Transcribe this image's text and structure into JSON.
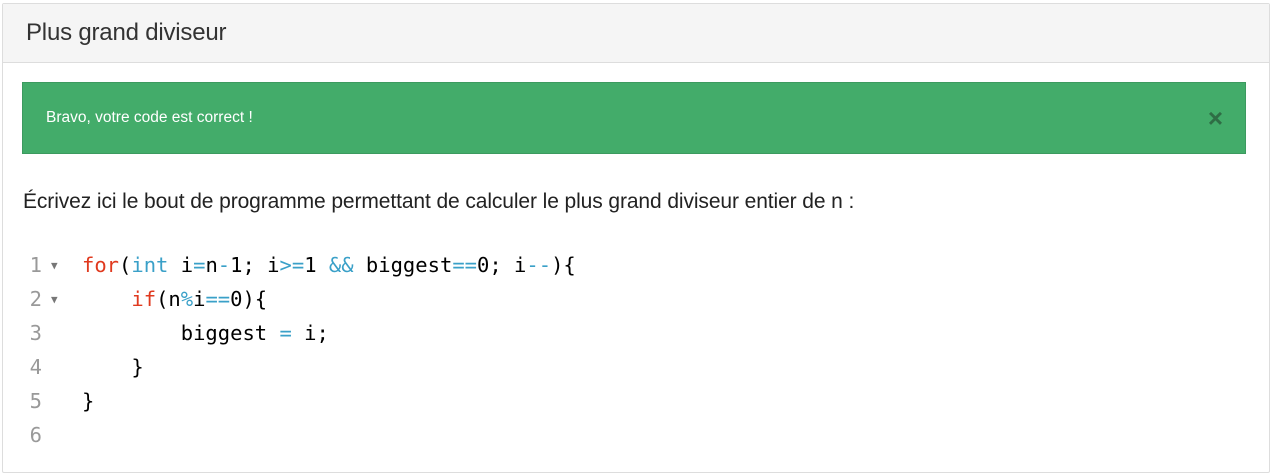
{
  "panel": {
    "title": "Plus grand diviseur"
  },
  "alert": {
    "message": "Bravo, votre code est correct !",
    "close_symbol": "×",
    "background_color": "#43ac6a"
  },
  "prompt": {
    "text": "Écrivez ici le bout de programme permettant de calculer le plus grand diviseur entier de n :"
  },
  "editor": {
    "lines": [
      {
        "number": "1",
        "foldable": true,
        "indent": "",
        "tokens": [
          {
            "t": "kw",
            "v": "for"
          },
          {
            "t": "plain",
            "v": "("
          },
          {
            "t": "ty",
            "v": "int"
          },
          {
            "t": "plain",
            "v": " i"
          },
          {
            "t": "op",
            "v": "="
          },
          {
            "t": "plain",
            "v": "n"
          },
          {
            "t": "op",
            "v": "-"
          },
          {
            "t": "plain",
            "v": "1; i"
          },
          {
            "t": "op",
            "v": ">="
          },
          {
            "t": "plain",
            "v": "1 "
          },
          {
            "t": "op",
            "v": "&&"
          },
          {
            "t": "plain",
            "v": " biggest"
          },
          {
            "t": "op",
            "v": "=="
          },
          {
            "t": "plain",
            "v": "0; i"
          },
          {
            "t": "op",
            "v": "--"
          },
          {
            "t": "plain",
            "v": "){"
          }
        ]
      },
      {
        "number": "2",
        "foldable": true,
        "indent": "    ",
        "tokens": [
          {
            "t": "kw",
            "v": "if"
          },
          {
            "t": "plain",
            "v": "(n"
          },
          {
            "t": "op",
            "v": "%"
          },
          {
            "t": "plain",
            "v": "i"
          },
          {
            "t": "op",
            "v": "=="
          },
          {
            "t": "plain",
            "v": "0){"
          }
        ]
      },
      {
        "number": "3",
        "foldable": false,
        "indent": "        ",
        "tokens": [
          {
            "t": "plain",
            "v": "biggest "
          },
          {
            "t": "op",
            "v": "="
          },
          {
            "t": "plain",
            "v": " i;"
          }
        ]
      },
      {
        "number": "4",
        "foldable": false,
        "indent": "    ",
        "tokens": [
          {
            "t": "plain",
            "v": "}"
          }
        ]
      },
      {
        "number": "5",
        "foldable": false,
        "indent": "",
        "tokens": [
          {
            "t": "plain",
            "v": "}"
          }
        ]
      },
      {
        "number": "6",
        "foldable": false,
        "indent": "",
        "tokens": []
      }
    ],
    "colors": {
      "keyword": "#e03a1f",
      "type": "#3aa0c8",
      "operator": "#3aa0c8",
      "gutter": "#999999"
    }
  }
}
